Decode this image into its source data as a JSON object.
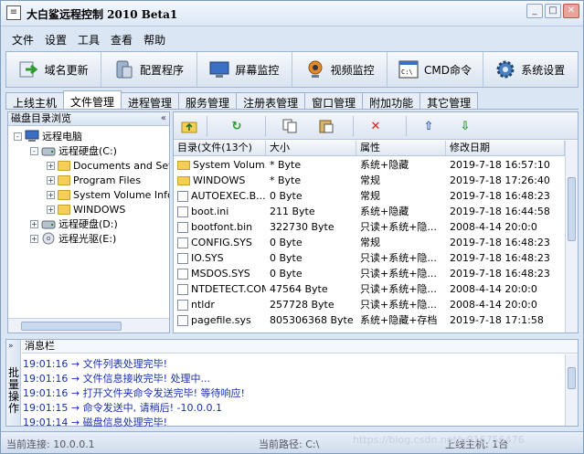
{
  "window": {
    "title": "大白鲨远程控制 2010 Beta1",
    "app_icon": "window-icon",
    "buttons": [
      "minimize-icon",
      "maximize-icon",
      "close-icon"
    ]
  },
  "menu": [
    "文件",
    "设置",
    "工具",
    "查看",
    "帮助"
  ],
  "toolbar": [
    {
      "label": "域名更新",
      "icon": "domain-update-icon",
      "color": "#3a9a3a"
    },
    {
      "label": "配置程序",
      "icon": "config-icon",
      "color": "#6a8bb0"
    },
    {
      "label": "屏幕监控",
      "icon": "monitor-icon",
      "color": "#3b6fc4"
    },
    {
      "label": "视频监控",
      "icon": "webcam-icon",
      "color": "#e08a2a"
    },
    {
      "label": "CMD命令",
      "icon": "cmd-icon",
      "color": "#333333"
    },
    {
      "label": "系统设置",
      "icon": "settings-gear-icon",
      "color": "#4a7fc0"
    }
  ],
  "tabs": [
    "上线主机",
    "文件管理",
    "进程管理",
    "服务管理",
    "注册表管理",
    "窗口管理",
    "附加功能",
    "其它管理"
  ],
  "active_tab": 1,
  "left_panel": {
    "header": "磁盘目录浏览",
    "collapse": "«",
    "tree": [
      {
        "label": "远程电脑",
        "toggle": "-"
      },
      {
        "label": "远程硬盘(C:)",
        "toggle": "-"
      },
      {
        "label": "Documents and Sett",
        "toggle": "+"
      },
      {
        "label": "Program Files",
        "toggle": "+"
      },
      {
        "label": "System Volume Infor",
        "toggle": "+"
      },
      {
        "label": "WINDOWS",
        "toggle": "+"
      },
      {
        "label": "远程硬盘(D:)",
        "toggle": "+"
      },
      {
        "label": "远程光驱(E:)",
        "toggle": "+"
      }
    ]
  },
  "file_toolbar": {
    "up": "↑",
    "refresh": "↻",
    "delete": "✕",
    "upload": "⇧",
    "download": "⇩"
  },
  "file_table": {
    "headers": [
      "目录(文件(13个)",
      "大小",
      "属性",
      "修改日期"
    ],
    "rows": [
      [
        "System Volum...",
        "* Byte",
        "系统+隐藏",
        "2019-7-18 16:57:10",
        "folder"
      ],
      [
        "WINDOWS",
        "* Byte",
        "常规",
        "2019-7-18 17:26:40",
        "folder"
      ],
      [
        "AUTOEXEC.B...",
        "0 Byte",
        "常规",
        "2019-7-18 16:48:23",
        "file"
      ],
      [
        "boot.ini",
        "211 Byte",
        "系统+隐藏",
        "2019-7-18 16:44:58",
        "file"
      ],
      [
        "bootfont.bin",
        "322730 Byte",
        "只读+系统+隐...",
        "2008-4-14 20:0:0",
        "file"
      ],
      [
        "CONFIG.SYS",
        "0 Byte",
        "常规",
        "2019-7-18 16:48:23",
        "file"
      ],
      [
        "IO.SYS",
        "0 Byte",
        "只读+系统+隐...",
        "2019-7-18 16:48:23",
        "file"
      ],
      [
        "MSDOS.SYS",
        "0 Byte",
        "只读+系统+隐...",
        "2019-7-18 16:48:23",
        "file"
      ],
      [
        "NTDETECT.COM",
        "47564 Byte",
        "只读+系统+隐...",
        "2008-4-14 20:0:0",
        "file"
      ],
      [
        "ntldr",
        "257728 Byte",
        "只读+系统+隐...",
        "2008-4-14 20:0:0",
        "file"
      ],
      [
        "pagefile.sys",
        "805306368 Byte",
        "系统+隐藏+存档",
        "2019-7-18 17:1:58",
        "file"
      ]
    ]
  },
  "message_panel": {
    "header": "消息栏",
    "side_label": "批量操作",
    "collapse": "»",
    "lines": [
      "19:01:16 → 文件列表处理完毕!",
      "19:01:16 → 文件信息接收完毕! 处理中...",
      "19:01:16 → 打开文件夹命令发送完毕! 等待响应!",
      "19:01:15 → 命令发送中, 请稍后! -10.0.0.1",
      "19:01:14 → 磁盘信息处理完毕!"
    ]
  },
  "status": {
    "connection": "当前连接: 10.0.0.1",
    "path": "当前路径: C:\\",
    "hosts": "上线主机: 1台"
  },
  "watermark": "https://blog.csdn.net/u016756476"
}
